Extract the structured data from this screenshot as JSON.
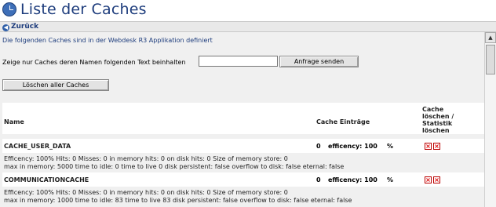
{
  "page": {
    "title": "Liste der Caches",
    "back_label": "Zurück",
    "description": "Die folgenden Caches sind in der Webdesk R3 Applikation definiert",
    "filter_label": "Zeige nur Caches deren Namen folgenden Text beinhalten",
    "filter_value": "",
    "send_button": "Anfrage senden",
    "delete_all_button": "Löschen aller Caches"
  },
  "table": {
    "headers": {
      "name": "Name",
      "entries": "Cache Einträge",
      "actions_l1": "Cache",
      "actions_l2": "löschen /",
      "actions_l3": "Statistik",
      "actions_l4": "löschen"
    },
    "rows": [
      {
        "name": "CACHE_USER_DATA",
        "count": "0",
        "efficiency": "efficency: 100",
        "percent": "%",
        "line1": "Efficency: 100% Hits: 0 Misses: 0 in memory hits: 0 on disk hits: 0 Size of memory store: 0",
        "line2": "max in memory: 5000 time to idle: 0 time to live 0 disk persistent: false overflow to disk: false eternal: false"
      },
      {
        "name": "COMMUNICATIONCACHE",
        "count": "0",
        "efficiency": "efficency: 100",
        "percent": "%",
        "line1": "Efficency: 100% Hits: 0 Misses: 0 in memory hits: 0 on disk hits: 0 Size of memory store: 0",
        "line2": "max in memory: 1000 time to idle: 83 time to live 83 disk persistent: false overflow to disk: false eternal: false"
      }
    ]
  },
  "icons": {
    "title_icon": "clock-icon",
    "back_icon": "back-arrow-icon",
    "delete_icon": "delete-x-icon",
    "stats_icon": "reset-stats-x-icon"
  },
  "colors": {
    "title": "#1d3c7c",
    "delete_red": "#d00000",
    "content_bg": "#f0f0f0"
  }
}
